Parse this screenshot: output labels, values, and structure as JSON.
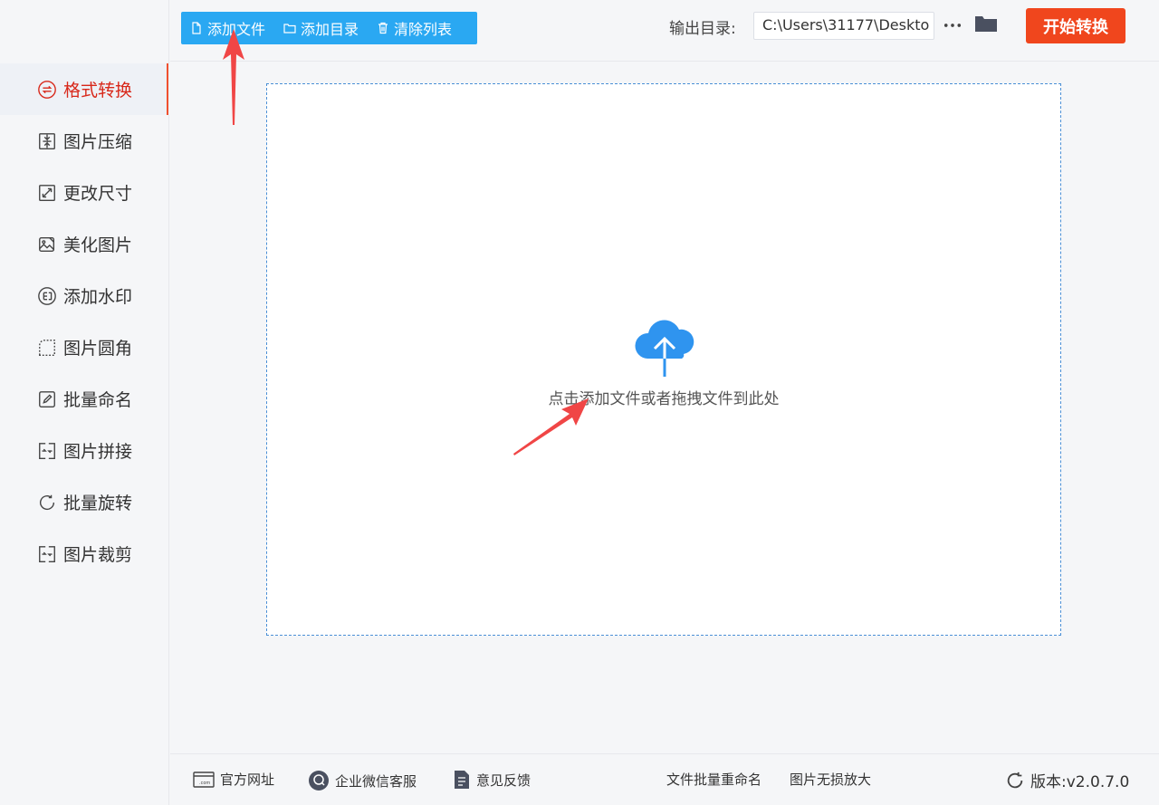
{
  "sidebar": {
    "items": [
      {
        "label": "格式转换",
        "icon": "format-convert-icon",
        "active": true
      },
      {
        "label": "图片压缩",
        "icon": "compress-icon"
      },
      {
        "label": "更改尺寸",
        "icon": "resize-icon"
      },
      {
        "label": "美化图片",
        "icon": "beautify-icon"
      },
      {
        "label": "添加水印",
        "icon": "watermark-icon"
      },
      {
        "label": "图片圆角",
        "icon": "round-corner-icon"
      },
      {
        "label": "批量命名",
        "icon": "rename-icon"
      },
      {
        "label": "图片拼接",
        "icon": "stitch-icon"
      },
      {
        "label": "批量旋转",
        "icon": "rotate-icon"
      },
      {
        "label": "图片裁剪",
        "icon": "crop-icon"
      }
    ]
  },
  "toolbar": {
    "add_file": "添加文件",
    "add_folder": "添加目录",
    "clear_list": "清除列表",
    "output_label": "输出目录:",
    "output_path": "C:\\Users\\31177\\Deskto",
    "more": "···",
    "start": "开始转换"
  },
  "dropzone": {
    "hint": "点击添加文件或者拖拽文件到此处"
  },
  "footer": {
    "website": "官方网址",
    "wechat": "企业微信客服",
    "feedback": "意见反馈",
    "batch_rename": "文件批量重命名",
    "upscale": "图片无损放大",
    "version": "版本:v2.0.7.0"
  },
  "colors": {
    "accent_blue": "#2aa8f2",
    "start_red": "#f0461d",
    "active_red": "#d8281a",
    "arrow_red": "#f04646"
  }
}
